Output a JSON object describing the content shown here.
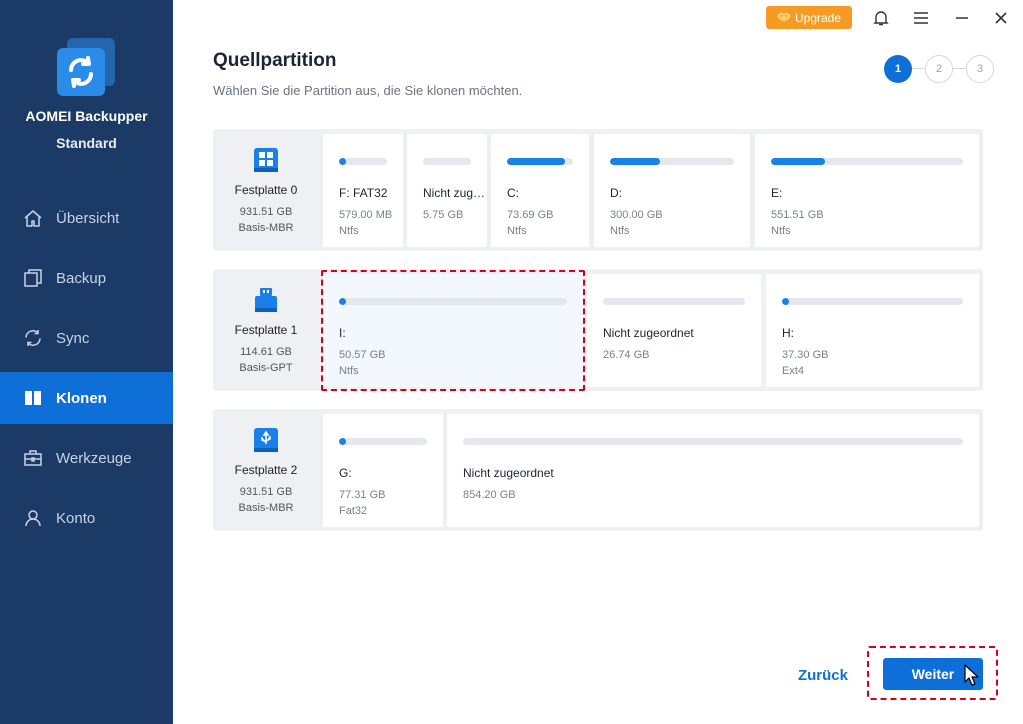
{
  "app": {
    "name": "AOMEI Backupper",
    "edition": "Standard"
  },
  "sidebar": {
    "items": [
      {
        "label": "Übersicht",
        "icon": "home-icon",
        "active": false
      },
      {
        "label": "Backup",
        "icon": "backup-icon",
        "active": false
      },
      {
        "label": "Sync",
        "icon": "sync-icon",
        "active": false
      },
      {
        "label": "Klonen",
        "icon": "clone-icon",
        "active": true
      },
      {
        "label": "Werkzeuge",
        "icon": "toolbox-icon",
        "active": false
      },
      {
        "label": "Konto",
        "icon": "user-icon",
        "active": false
      }
    ]
  },
  "topbar": {
    "upgrade_label": "Upgrade"
  },
  "header": {
    "title": "Quellpartition",
    "subtitle": "Wählen Sie die Partition aus, die Sie klonen möchten."
  },
  "steps": [
    "1",
    "2",
    "3"
  ],
  "disks": [
    {
      "name": "Festplatte 0",
      "size": "931.51 GB",
      "type": "Basis-MBR",
      "partitions": [
        {
          "label": "F: FAT32",
          "size": "579.00 MB",
          "fs": "Ntfs",
          "used": 0.12
        },
        {
          "label": "Nicht zug…",
          "size": "5.75 GB",
          "fs": "",
          "used": 0
        },
        {
          "label": "C:",
          "size": "73.69 GB",
          "fs": "Ntfs",
          "used": 0.88
        },
        {
          "label": "D:",
          "size": "300.00 GB",
          "fs": "Ntfs",
          "used": 0.4
        },
        {
          "label": "E:",
          "size": "551.51 GB",
          "fs": "Ntfs",
          "used": 0.28
        }
      ]
    },
    {
      "name": "Festplatte 1",
      "size": "114.61 GB",
      "type": "Basis-GPT",
      "partitions": [
        {
          "label": "I:",
          "size": "50.57 GB",
          "fs": "Ntfs",
          "used": 0.015
        },
        {
          "label": "Nicht zugeordnet",
          "size": "26.74 GB",
          "fs": "",
          "used": 0
        },
        {
          "label": "H:",
          "size": "37.30 GB",
          "fs": "Ext4",
          "used": 0.02
        }
      ]
    },
    {
      "name": "Festplatte 2",
      "size": "931.51 GB",
      "type": "Basis-MBR",
      "partitions": [
        {
          "label": "G:",
          "size": "77.31 GB",
          "fs": "Fat32",
          "used": 0.04
        },
        {
          "label": "Nicht zugeordnet",
          "size": "854.20 GB",
          "fs": "",
          "used": 0
        }
      ]
    }
  ],
  "footer": {
    "back_label": "Zurück",
    "next_label": "Weiter"
  },
  "colors": {
    "sidebar": "#1c3a66",
    "accent": "#0f6fd8",
    "upgrade": "#f59a23",
    "highlight": "#d5001c"
  }
}
